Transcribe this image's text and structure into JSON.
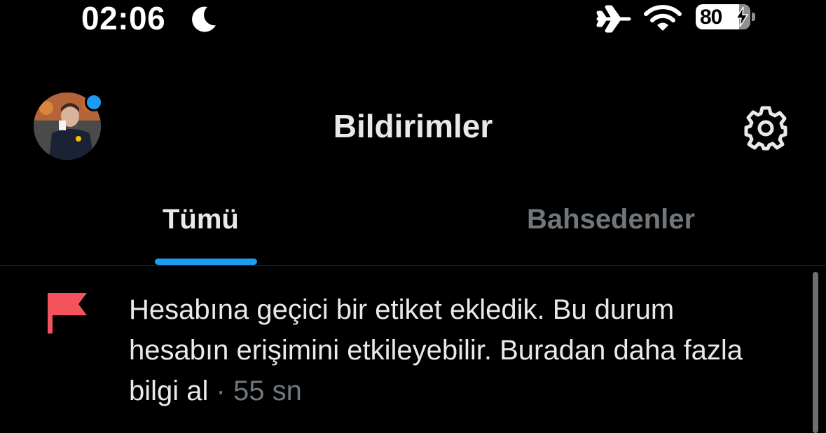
{
  "status_bar": {
    "time": "02:06",
    "battery_level": "80",
    "icons": [
      "moon-icon",
      "airplane-icon",
      "wifi-icon",
      "battery-icon"
    ]
  },
  "header": {
    "title": "Bildirimler",
    "avatar_badge_color": "#1d9bf0",
    "settings_icon": "gear-icon"
  },
  "tabs": [
    {
      "label": "Tümü",
      "active": true
    },
    {
      "label": "Bahsedenler",
      "active": false
    }
  ],
  "notifications": [
    {
      "icon": "flag-icon",
      "icon_color": "#f4525c",
      "text": "Hesabına geçici bir etiket ekledik. Bu durum hesabın erişimini etkileyebilir. Buradan daha fazla bilgi al",
      "separator": "·",
      "time": "55 sn"
    }
  ],
  "colors": {
    "background": "#000000",
    "accent": "#1d9bf0",
    "primary_text": "#e7e9ea",
    "secondary_text": "#71767b"
  }
}
